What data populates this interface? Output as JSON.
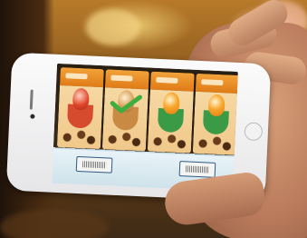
{
  "scene": {
    "description_colors": {
      "background": "#8a5a1e",
      "phone_body": "#f3f3f3",
      "screen_tint": "#ddeef5",
      "pack_orange": "#f2a23a",
      "check_green": "#3fae3f",
      "price_tag_border": "#2f5a86"
    }
  },
  "phone": {
    "screen": {
      "packs": [
        {
          "icon": "dessert-pack-icon",
          "checked": false,
          "cup_color": "#d64a2e"
        },
        {
          "icon": "dessert-pack-icon",
          "checked": true,
          "cup_color": "#c98b44"
        },
        {
          "icon": "dessert-pack-icon",
          "checked": false,
          "cup_color": "#3a9a45"
        },
        {
          "icon": "dessert-pack-icon",
          "checked": false,
          "cup_color": "#3a9a45"
        }
      ],
      "price_tags": [
        {
          "icon": "electronic-price-label-icon"
        },
        {
          "icon": "electronic-price-label-icon"
        }
      ]
    }
  }
}
